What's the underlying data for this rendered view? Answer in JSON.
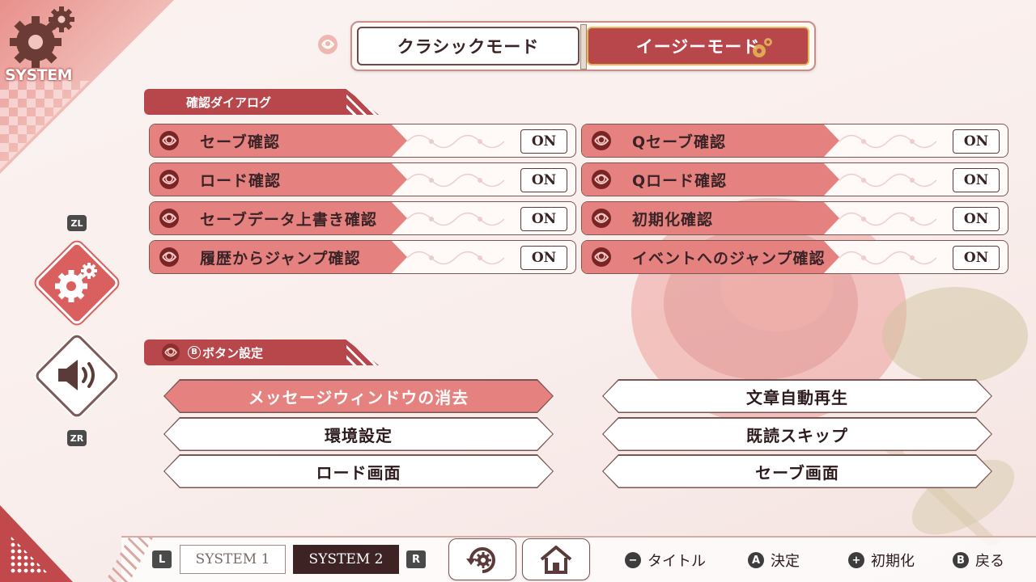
{
  "corner": {
    "label": "SYSTEM"
  },
  "mode_switch": {
    "classic": "クラシックモード",
    "easy": "イージーモード"
  },
  "confirm_section": {
    "title": "確認ダイアログ",
    "rows": [
      {
        "label": "セーブ確認",
        "value": "ON"
      },
      {
        "label": "Qセーブ確認",
        "value": "ON"
      },
      {
        "label": "ロード確認",
        "value": "ON"
      },
      {
        "label": "Qロード確認",
        "value": "ON"
      },
      {
        "label": "セーブデータ上書き確認",
        "value": "ON"
      },
      {
        "label": "初期化確認",
        "value": "ON"
      },
      {
        "label": "履歴からジャンプ確認",
        "value": "ON"
      },
      {
        "label": "イベントへのジャンプ確認",
        "value": "ON"
      }
    ]
  },
  "b_section": {
    "b_glyph": "B",
    "title": "ボタン設定",
    "options": [
      {
        "label": "メッセージウィンドウの消去",
        "active": true
      },
      {
        "label": "文章自動再生",
        "active": false
      },
      {
        "label": "環境設定",
        "active": false
      },
      {
        "label": "既読スキップ",
        "active": false
      },
      {
        "label": "ロード画面",
        "active": false
      },
      {
        "label": "セーブ画面",
        "active": false
      }
    ]
  },
  "side_nav": {
    "zl": "ZL",
    "zr": "ZR",
    "items": [
      "gear-icon",
      "speaker-icon"
    ]
  },
  "bottom": {
    "key_l": "L",
    "key_r": "R",
    "tab1": "SYSTEM 1",
    "tab2": "SYSTEM 2",
    "hints": [
      {
        "glyph": "−",
        "label": "タイトル"
      },
      {
        "glyph": "A",
        "label": "決定"
      },
      {
        "glyph": "+",
        "label": "初期化"
      },
      {
        "glyph": "B",
        "label": "戻る"
      }
    ]
  },
  "colors": {
    "accent": "#b8474b",
    "row_fill": "#e5827f",
    "bg": "#fbf3f1"
  }
}
